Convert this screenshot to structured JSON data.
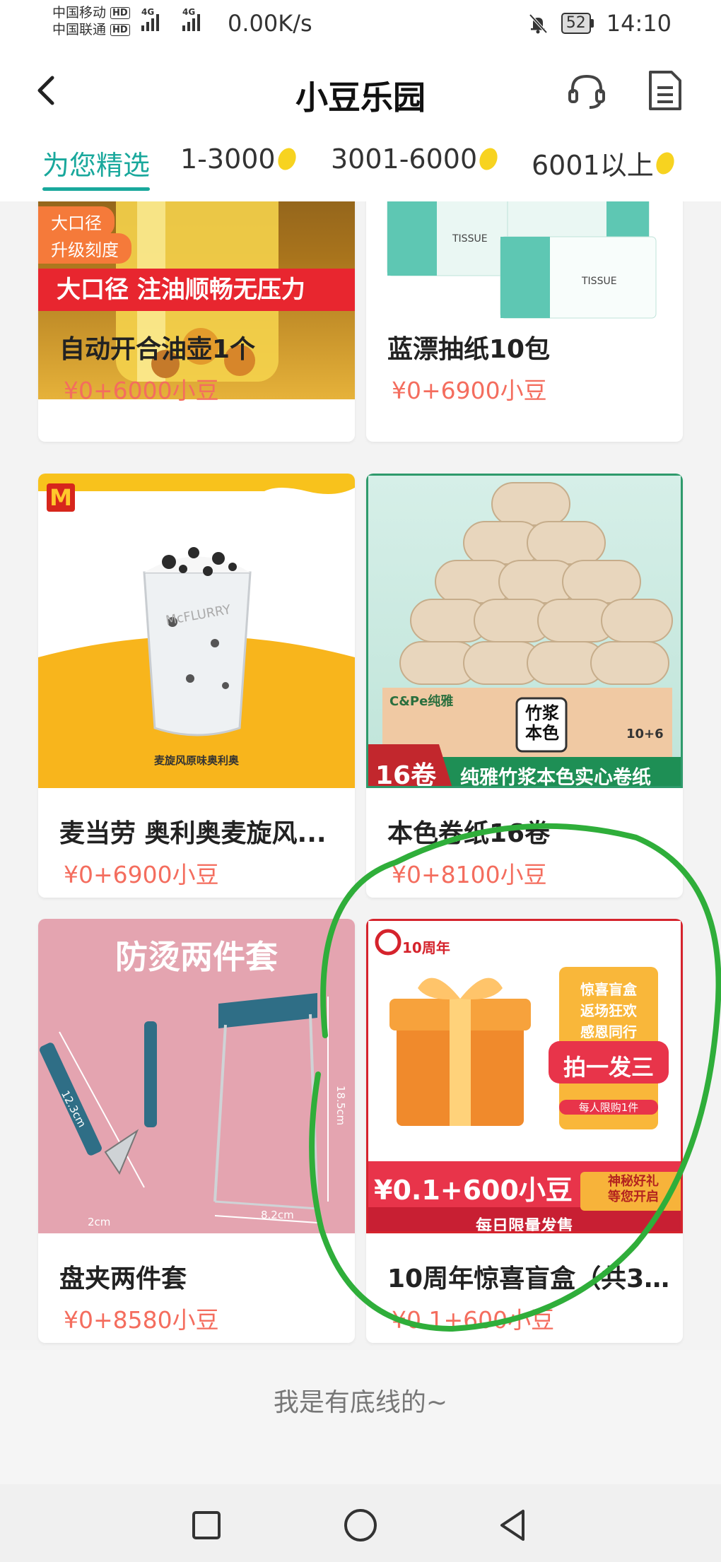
{
  "status_bar": {
    "carrier_1": "中国移动",
    "carrier_2": "中国联通",
    "hd_badge": "HD",
    "network_type": "4G",
    "net_speed": "0.00K/s",
    "battery": "52",
    "time": "14:10"
  },
  "header": {
    "title": "小豆乐园"
  },
  "tabs": [
    {
      "label": "为您精选",
      "active": true
    },
    {
      "label": "1-3000"
    },
    {
      "label": "3001-6000"
    },
    {
      "label": "6001以上"
    }
  ],
  "products": [
    {
      "name": "自动开合油壶1个",
      "price": "¥0+6000小豆",
      "tags": [
        "大口径",
        "升级刻度"
      ],
      "banner": "大口径 注油顺畅无压力"
    },
    {
      "name": "蓝漂抽纸10包",
      "price": "¥0+6900小豆",
      "box_text": "TISSUE"
    },
    {
      "name": "麦当劳 奥利奥麦旋风...",
      "price": "¥0+6900小豆",
      "caption": "麦旋风原味奥利奥",
      "cup_text": "McFLURRY"
    },
    {
      "name": "本色卷纸16卷",
      "price": "¥0+8100小豆",
      "badge": "16卷",
      "banner": "纯雅竹浆本色实心卷纸",
      "box_brand": "C&Pe纯雅",
      "box_label": "竹浆本色",
      "box_count": "10+6"
    },
    {
      "name": "盘夹两件套",
      "price": "¥0+8580小豆",
      "banner": "防烫两件套",
      "dim_1": "12.3cm",
      "dim_2": "2cm",
      "dim_3": "8.2cm",
      "dim_4": "18.5cm"
    },
    {
      "name": "10周年惊喜盲盒（共3...",
      "price": "¥0.1+600小豆",
      "anniv": "10周年",
      "promo_lines": [
        "惊喜盲盒",
        "返场狂欢",
        "感恩同行"
      ],
      "promo_button": "拍一发三",
      "limit": "每人限购1件",
      "price_banner": "¥0.1+600小豆",
      "side_text": [
        "神秘好礼",
        "等您开启"
      ],
      "daily": "每日限量发售"
    }
  ],
  "footer": {
    "text": "我是有底线的~"
  },
  "colors": {
    "accent": "#19a89c",
    "price": "#f46d5e",
    "annotation": "#2fae3a"
  }
}
